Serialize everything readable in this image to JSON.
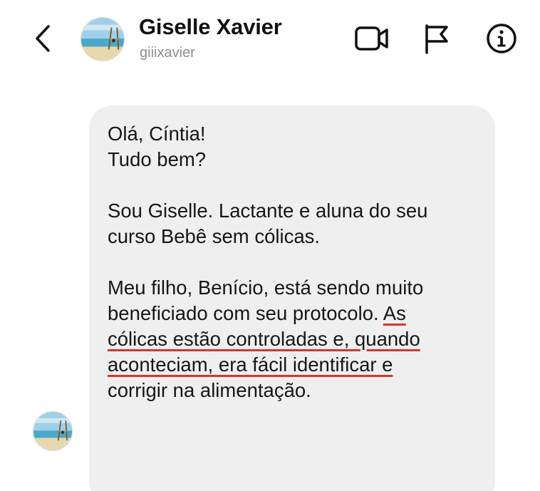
{
  "header": {
    "name": "Giselle Xavier",
    "username": "giiixavier",
    "icons": [
      "back-chevron-icon",
      "video-call-icon",
      "flag-icon",
      "info-icon"
    ]
  },
  "message": {
    "greeting_1": "Olá, Cíntia!",
    "greeting_2": "Tudo bem?",
    "intro_1": "Sou Giselle. Lactante e aluna do seu",
    "intro_2": "curso Bebê sem cólicas.",
    "body_1": "Meu filho, Benício, está sendo muito",
    "body_2a": "beneficiado com seu protocolo. ",
    "body_2b": "As",
    "body_3": "cólicas estão controladas e, quando",
    "body_4": "aconteciam, era fácil identificar e",
    "body_5": "corrigir na alimentação."
  },
  "colors": {
    "bubble": "#efefef",
    "highlight_underline": "#d9342b",
    "muted_text": "#8e8e8e"
  }
}
